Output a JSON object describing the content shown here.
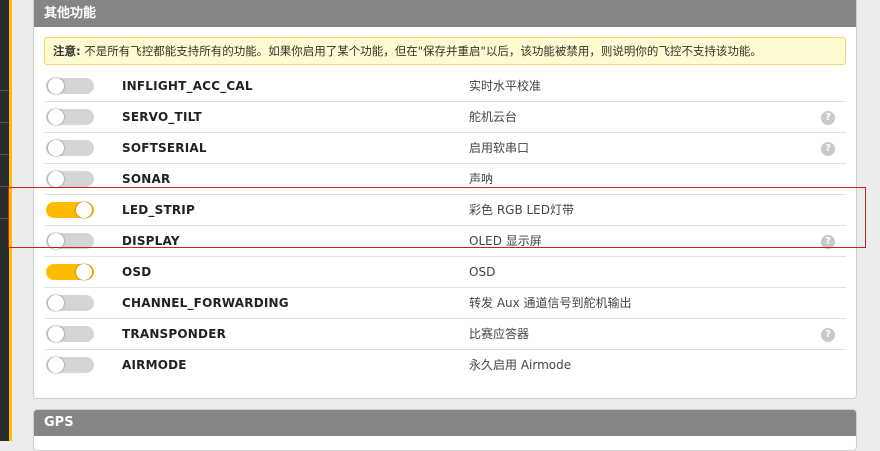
{
  "colors": {
    "accent": "#ffbb00",
    "header": "#858585",
    "notice_bg": "#fffbd0",
    "highlight": "#cc2222"
  },
  "features_panel": {
    "title": "其他功能",
    "notice_label": "注意:",
    "notice_text": "不是所有飞控都能支持所有的功能。如果你启用了某个功能，但在\"保存并重启\"以后，该功能被禁用，则说明你的飞控不支持该功能。",
    "rows": [
      {
        "name": "INFLIGHT_ACC_CAL",
        "desc": "实时水平校准",
        "enabled": false,
        "help": false
      },
      {
        "name": "SERVO_TILT",
        "desc": "舵机云台",
        "enabled": false,
        "help": true
      },
      {
        "name": "SOFTSERIAL",
        "desc": "启用软串口",
        "enabled": false,
        "help": true
      },
      {
        "name": "SONAR",
        "desc": "声呐",
        "enabled": false,
        "help": false
      },
      {
        "name": "LED_STRIP",
        "desc": "彩色 RGB LED灯带",
        "enabled": true,
        "help": false
      },
      {
        "name": "DISPLAY",
        "desc": "OLED 显示屏",
        "enabled": false,
        "help": true
      },
      {
        "name": "OSD",
        "desc": "OSD",
        "enabled": true,
        "help": false
      },
      {
        "name": "CHANNEL_FORWARDING",
        "desc": "转发 Aux 通道信号到舵机输出",
        "enabled": false,
        "help": false
      },
      {
        "name": "TRANSPONDER",
        "desc": "比赛应答器",
        "enabled": false,
        "help": true
      },
      {
        "name": "AIRMODE",
        "desc": "永久启用 Airmode",
        "enabled": false,
        "help": false
      }
    ],
    "help_glyph": "?"
  },
  "gps_panel": {
    "title": "GPS"
  }
}
